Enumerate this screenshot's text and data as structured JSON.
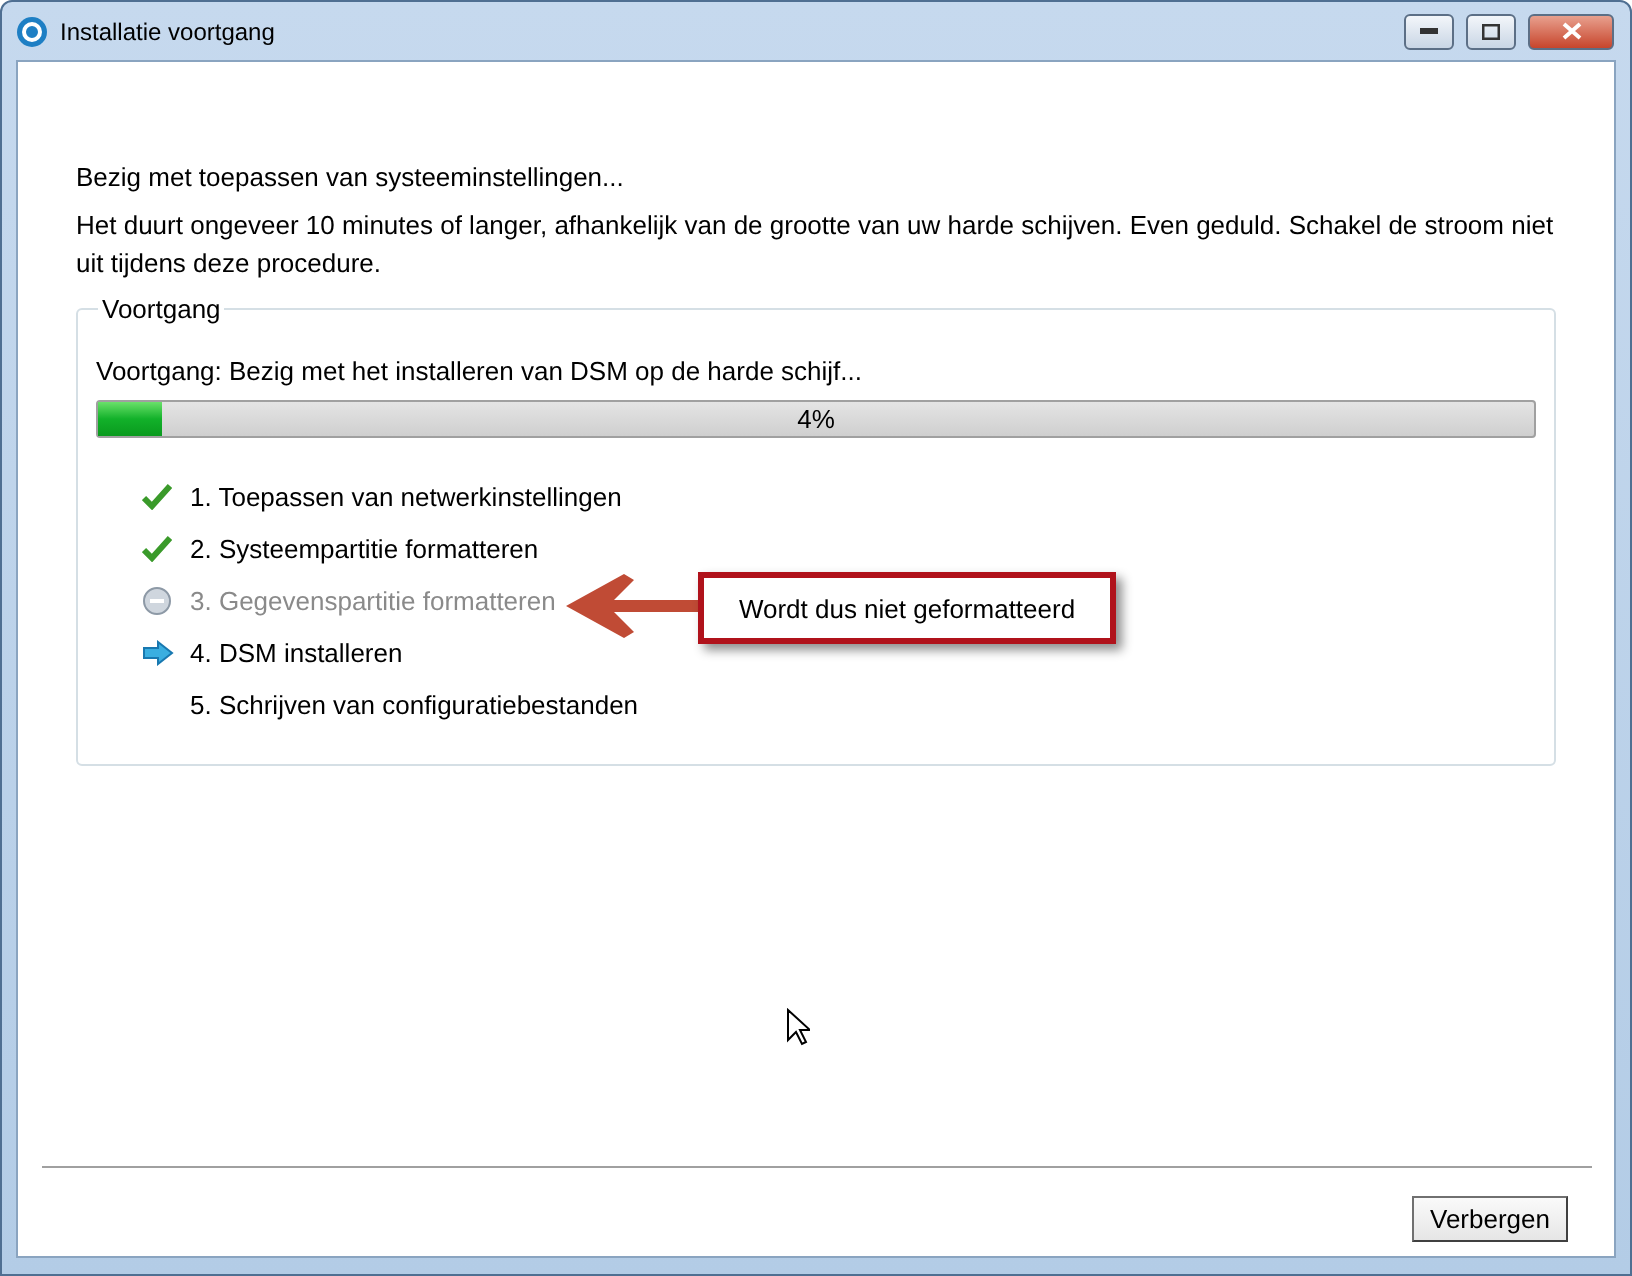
{
  "window": {
    "title": "Installatie voortgang"
  },
  "status": "Bezig met toepassen van systeeminstellingen...",
  "message": "Het duurt ongeveer 10 minutes of langer, afhankelijk van de grootte van uw harde schijven. Even geduld. Schakel de stroom niet uit tijdens deze procedure.",
  "progress_group": {
    "title": "Voortgang",
    "label": "Voortgang: Bezig met het installeren van DSM op de harde schijf...",
    "level": 0.045,
    "reading": "4%",
    "steps": [
      {
        "label": "1. Toepassen van netwerkinstellingen",
        "kind": "done"
      },
      {
        "label": "2. Systeempartitie formatteren",
        "kind": "done"
      },
      {
        "label": "3. Gegevenspartitie formatteren",
        "kind": "skipped"
      },
      {
        "label": "4. DSM installeren",
        "kind": "current"
      },
      {
        "label": "5. Schrijven van configuratiebestanden",
        "kind": "pending"
      }
    ]
  },
  "annotation": {
    "text": "Wordt dus niet geformatteerd"
  },
  "buttons": [
    "Verbergen"
  ]
}
